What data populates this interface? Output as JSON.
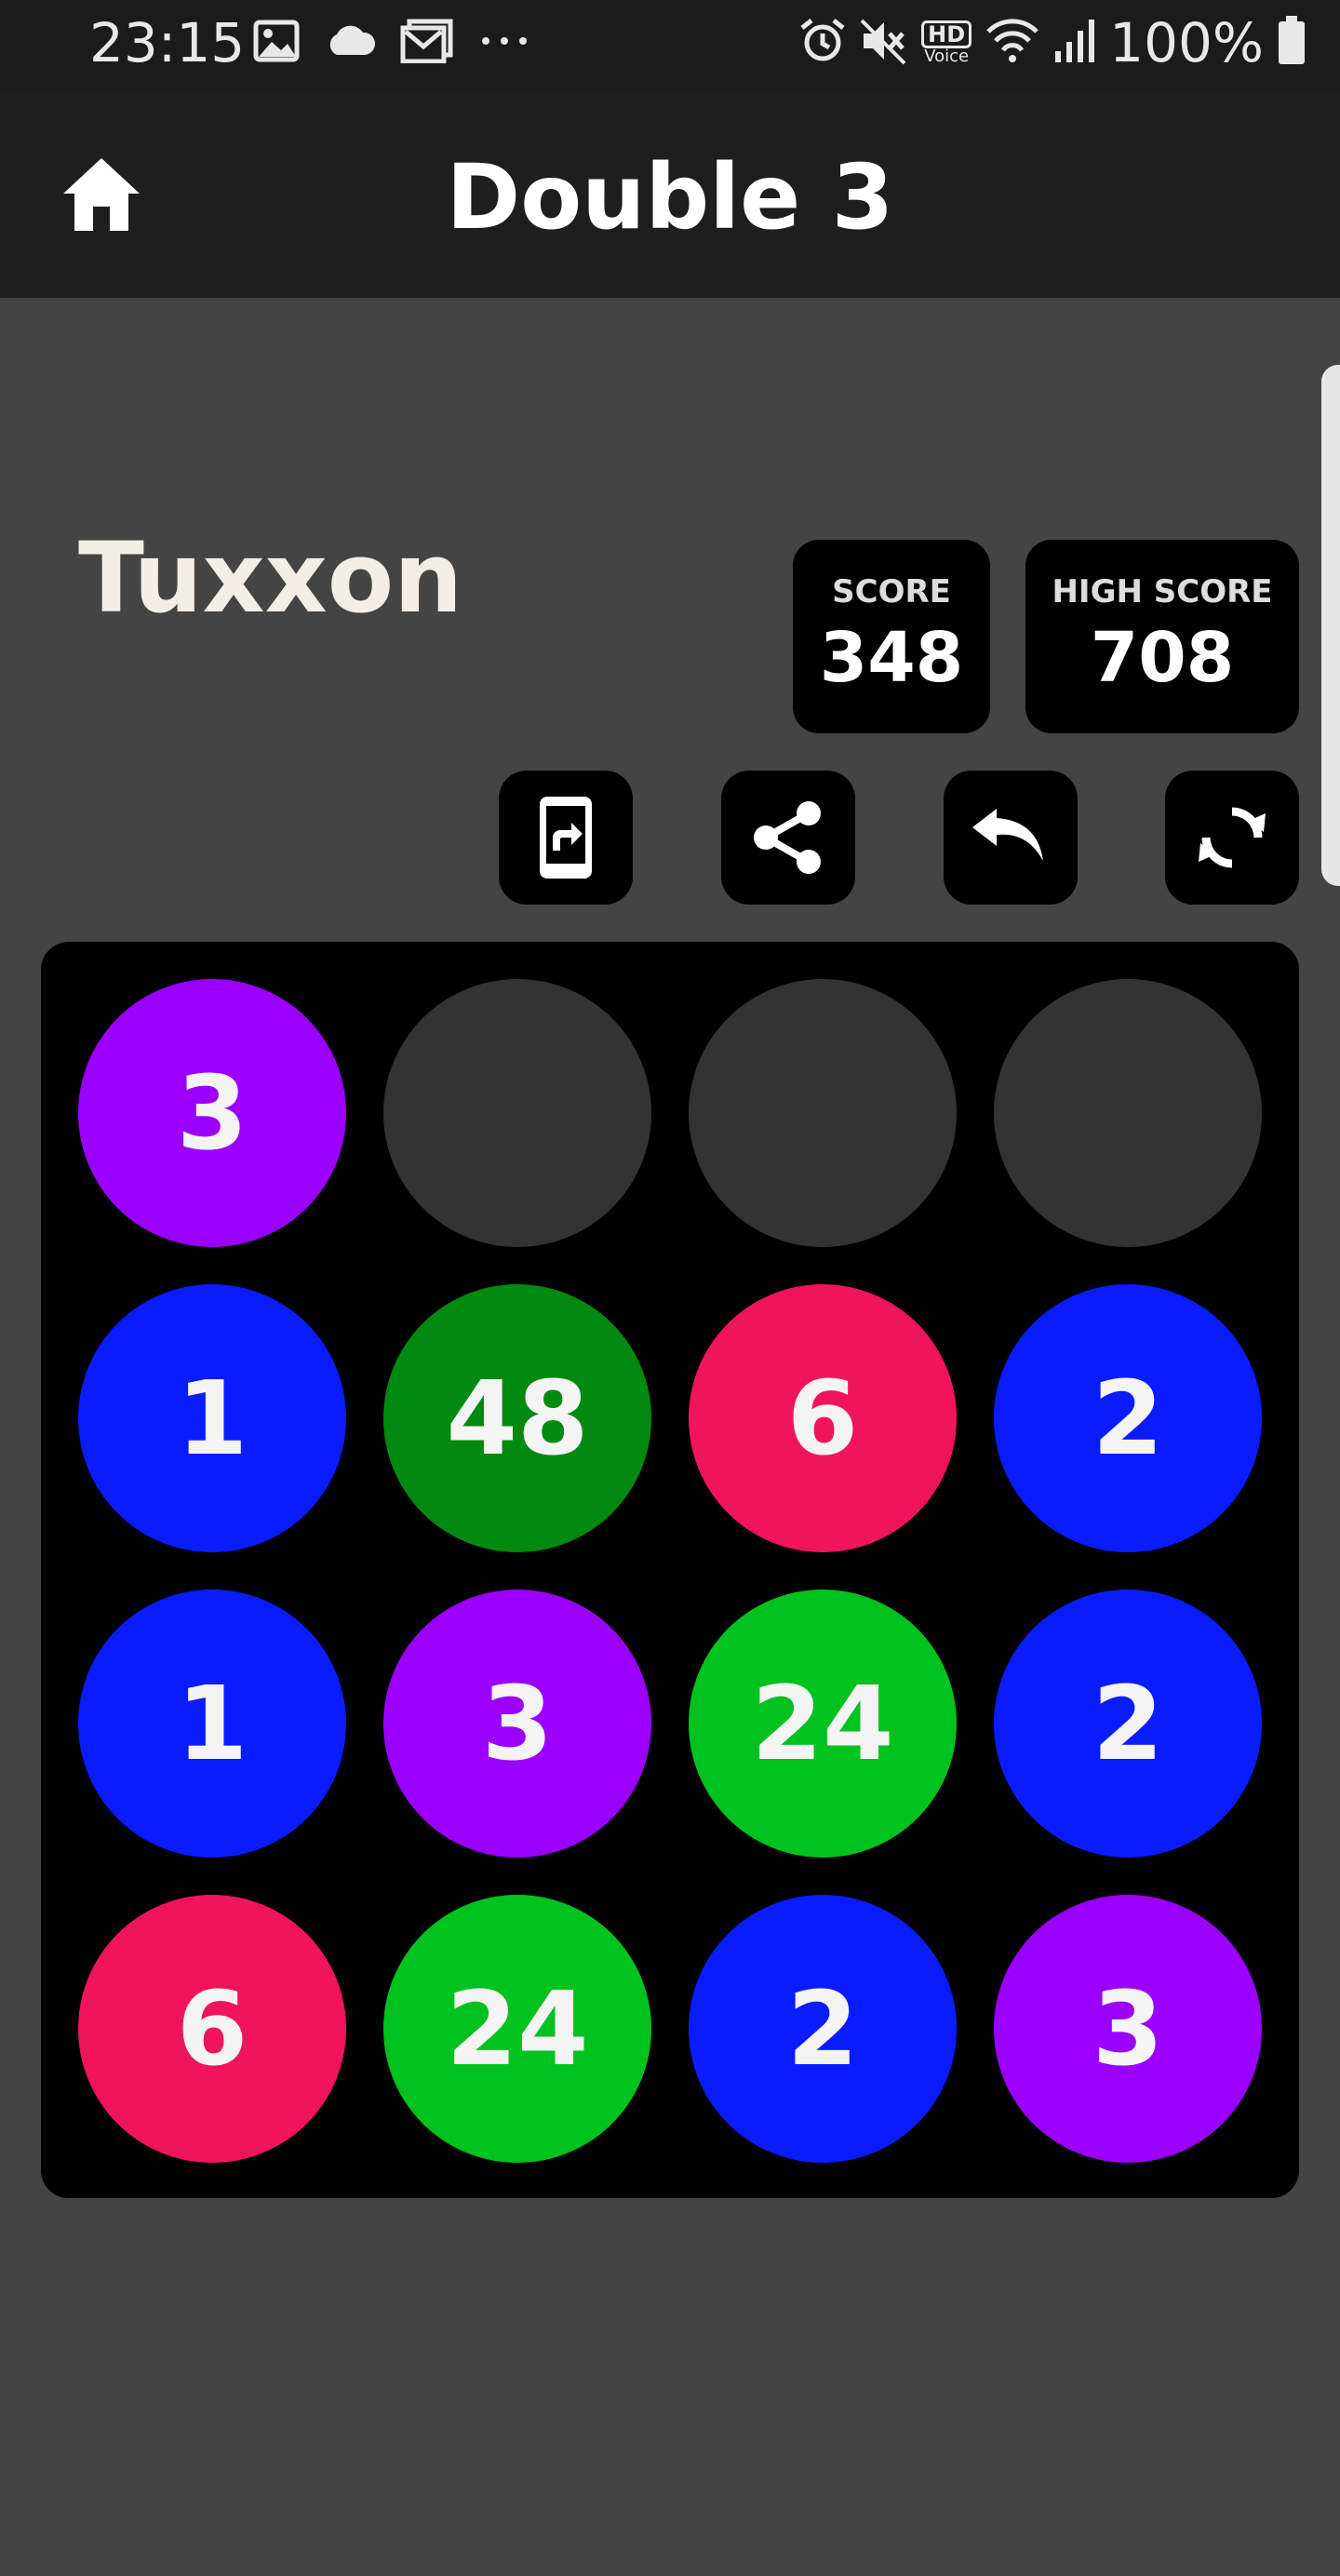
{
  "status_bar": {
    "time": "23:15",
    "battery_text": "100%",
    "left_icons": [
      "gallery-icon",
      "cloud-icon",
      "mail-icon",
      "more-dots-icon"
    ],
    "right_icons": [
      "alarm-icon",
      "mute-icon",
      "hd-voice-icon",
      "wifi-icon",
      "signal-icon",
      "battery-icon"
    ],
    "hd_label": "HD",
    "voice_label": "Voice"
  },
  "app_bar": {
    "title": "Double 3",
    "home_icon": "home-icon"
  },
  "player": {
    "name": "Tuxxon"
  },
  "scores": {
    "score_label": "SCORE",
    "score_value": "348",
    "high_label": "HIGH SCORE",
    "high_value": "708"
  },
  "controls": [
    {
      "name": "switch-device-icon"
    },
    {
      "name": "share-icon"
    },
    {
      "name": "undo-icon"
    },
    {
      "name": "restart-icon"
    }
  ],
  "colors": {
    "background": "#444444",
    "board": "#000000",
    "empty": "#333333",
    "value_1_2": "#0a1cff",
    "value_3": "#9b00ff",
    "value_6": "#f0145a",
    "value_24": "#00c21e",
    "value_48": "#008a10"
  },
  "board": {
    "rows": [
      [
        {
          "value": "3",
          "color": "#9b00ff"
        },
        {
          "value": "",
          "color": "#333333"
        },
        {
          "value": "",
          "color": "#333333"
        },
        {
          "value": "",
          "color": "#333333"
        }
      ],
      [
        {
          "value": "1",
          "color": "#0a1cff"
        },
        {
          "value": "48",
          "color": "#008a10"
        },
        {
          "value": "6",
          "color": "#f0145a"
        },
        {
          "value": "2",
          "color": "#0a1cff"
        }
      ],
      [
        {
          "value": "1",
          "color": "#0a1cff"
        },
        {
          "value": "3",
          "color": "#9b00ff"
        },
        {
          "value": "24",
          "color": "#00c21e"
        },
        {
          "value": "2",
          "color": "#0a1cff"
        }
      ],
      [
        {
          "value": "6",
          "color": "#f0145a"
        },
        {
          "value": "24",
          "color": "#00c21e"
        },
        {
          "value": "2",
          "color": "#0a1cff"
        },
        {
          "value": "3",
          "color": "#9b00ff"
        }
      ]
    ]
  }
}
